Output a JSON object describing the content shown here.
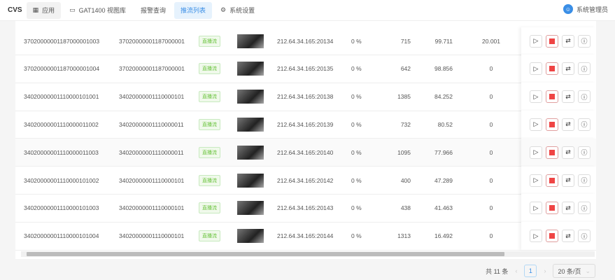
{
  "header": {
    "brand": "CVS",
    "nav": [
      {
        "label": "应用",
        "icon": "grid-icon"
      },
      {
        "label": "GAT1400 视图库",
        "icon": "folder-icon"
      },
      {
        "label": "报警查询"
      },
      {
        "label": "推流列表",
        "active": true
      },
      {
        "label": "系统设置",
        "icon": "gear-icon"
      }
    ],
    "user": "系统管理员"
  },
  "rows": [
    {
      "id": "37020000001187000001003",
      "device": "37020000001187000001",
      "type": "直播流",
      "addr": "212.64.34.165:20134",
      "loss": "0 %",
      "a": "715",
      "b": "99.711",
      "c": "20.001"
    },
    {
      "id": "37020000001187000001004",
      "device": "37020000001187000001",
      "type": "直播流",
      "addr": "212.64.34.165:20135",
      "loss": "0 %",
      "a": "642",
      "b": "98.856",
      "c": "0"
    },
    {
      "id": "34020000001110000101001",
      "device": "34020000001110000101",
      "type": "直播流",
      "addr": "212.64.34.165:20138",
      "loss": "0 %",
      "a": "1385",
      "b": "84.252",
      "c": "0"
    },
    {
      "id": "34020000001110000011002",
      "device": "34020000001110000011",
      "type": "直播流",
      "addr": "212.64.34.165:20139",
      "loss": "0 %",
      "a": "732",
      "b": "80.52",
      "c": "0"
    },
    {
      "id": "34020000001110000011003",
      "device": "34020000001110000011",
      "type": "直播流",
      "addr": "212.64.34.165:20140",
      "loss": "0 %",
      "a": "1095",
      "b": "77.966",
      "c": "0"
    },
    {
      "id": "34020000001110000101002",
      "device": "34020000001110000101",
      "type": "直播流",
      "addr": "212.64.34.165:20142",
      "loss": "0 %",
      "a": "400",
      "b": "47.289",
      "c": "0"
    },
    {
      "id": "34020000001110000101003",
      "device": "34020000001110000101",
      "type": "直播流",
      "addr": "212.64.34.165:20143",
      "loss": "0 %",
      "a": "438",
      "b": "41.463",
      "c": "0"
    },
    {
      "id": "34020000001110000101004",
      "device": "34020000001110000101",
      "type": "直播流",
      "addr": "212.64.34.165:20144",
      "loss": "0 %",
      "a": "1313",
      "b": "16.492",
      "c": "0"
    }
  ],
  "pagination": {
    "total": "共 11 条",
    "page": "1",
    "size": "20 条/页"
  }
}
